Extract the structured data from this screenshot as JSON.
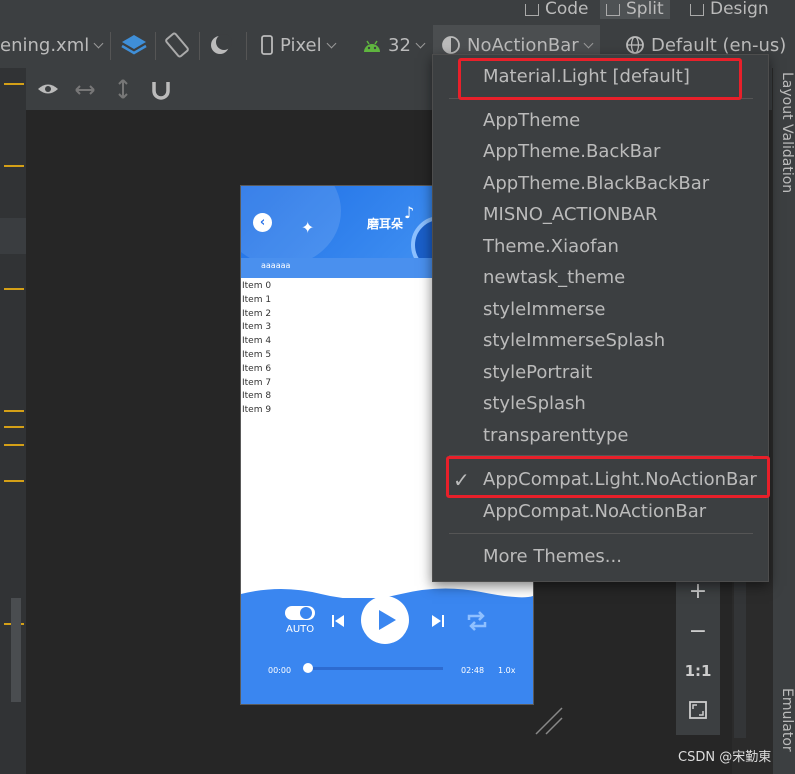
{
  "view_modes": {
    "code": "Code",
    "split": "Split",
    "design": "Design"
  },
  "toolbar": {
    "file": "ening.xml",
    "device": "Pixel",
    "api": "32",
    "theme": "NoActionBar",
    "locale": "Default (en-us)"
  },
  "theme_menu": {
    "items": [
      "Material.Light [default]",
      "AppTheme",
      "AppTheme.BackBar",
      "AppTheme.BlackBackBar",
      "MISNO_ACTIONBAR",
      "Theme.Xiaofan",
      "newtask_theme",
      "styleImmerse",
      "styleImmerseSplash",
      "stylePortrait",
      "styleSplash",
      "transparenttype"
    ],
    "selected": "AppCompat.Light.NoActionBar",
    "other": "AppCompat.NoActionBar",
    "more": "More Themes..."
  },
  "phone": {
    "title": "磨耳朵",
    "tab_label": "aaaaaa",
    "list": [
      "Item 0",
      "Item 1",
      "Item 2",
      "Item 3",
      "Item 4",
      "Item 5",
      "Item 6",
      "Item 7",
      "Item 8",
      "Item 9"
    ],
    "auto_label": "AUTO",
    "time_start": "00:00",
    "time_end": "02:48",
    "speed": "1.0x"
  },
  "zoom": {
    "one_to_one": "1:1"
  },
  "side_labels": {
    "validation": "Layout Validation",
    "emulator": "Emulator"
  },
  "watermark": "CSDN @宋勤東",
  "colors": {
    "highlight_box": "#e8202a",
    "phone_blue": "#3a86f0",
    "gutter_mark": "#d4a017"
  }
}
